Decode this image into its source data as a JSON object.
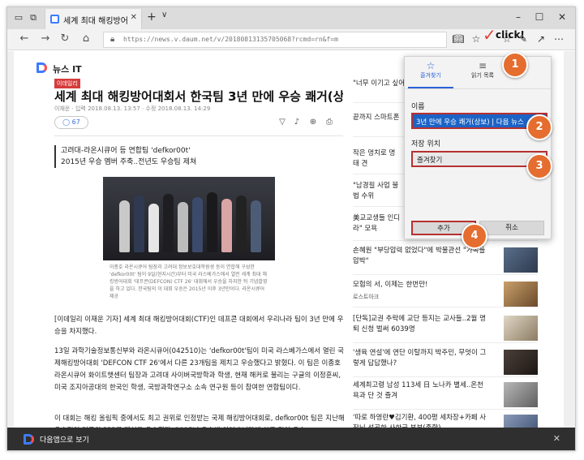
{
  "tab": {
    "title": "세계 최대 해킹방어대회"
  },
  "nav": {
    "url": "https://news.v.daum.net/v/20180813135705068?rcmd=rn&f=m"
  },
  "brand": {
    "section": "뉴스 IT"
  },
  "article": {
    "press": "이데일리",
    "headline": "세계 최대 해킹방어대회서 한국팀 3년 만에 우승 쾌거(상보)",
    "byline": "이재운 · 입력 2018.08.13. 13:57 · 수정 2018.08.13. 14:29",
    "comments": "67",
    "summary": [
      "고려대-라온시큐어 등 연합팀 'defkor00t'",
      "2015년 우승 멤버 주축..전년도 우승팀 제쳐"
    ],
    "caption": "이종호 라온시큐어 팀장과 고려대 정보보호대학원생 등이 연합해 구성한 'defkor00t' 팀이 9일(현지시간)부터 미국 라스베가스에서 열린 세계 최대 해킹방어대회 '데프콘(DEFCON) CTF 26' 대회에서 우승을 차지한 뒤 기념촬영을 하고 있다. 한국팀의 이 대회 우승은 2015년 이후 3년만이다. 라온시큐어 제공",
    "paragraphs": [
      "[이데일리 이재운 기자] 세계 최대 해킹방어대회(CTF)인 데프콘 대회에서 우리나라 팀이 3년 만에 우승을 차지했다.",
      "13일 과학기술정보통신부와 라온시큐어(042510)는 'defkor00t'팀이 미국 라스베가스에서 열린 국제해킹방어대회 'DEFCON CTF 26'에서 다른 23개팀을 제치고 우승했다고 밝혔다. 이 팀은 이종호 라온시큐어 화이트햇센터 팀장과 고려대 사이버국방학과 학생, 현재 해커로 불리는 구글의 이정훈씨, 미국 조지아공대의 한국인 학생, 국방과학연구소 소속 연구원 등이 참여한 연합팀이다.",
      "이 대회는 해킹 올림픽 중에서도 최고 권위로 인정받는 국제 해킹방어대회로, defkor00t 팀은 지난해 우승팀인 미국의 PPP를 제치고 우승했다. 2015년 우승에 이어 3년만에 한국 팀이 우승"
    ]
  },
  "right_column": [
    {
      "text": "\"너무 이기고 싶어",
      "thumb": false
    },
    {
      "text": "끝까지 스마트폰",
      "thumb": false
    },
    {
      "text": "작은 멍치로 명태 견",
      "thumb": false
    },
    {
      "text": "\"남경필 사업 불법 수위",
      "thumb": false
    },
    {
      "text": "美교교생들 인디 라\" 모욕",
      "thumb": false
    },
    {
      "text": "손혜원 \"부당압력 없었다\"에 박물관선 \"가족들 압박\"",
      "thumb": true
    },
    {
      "text": "모험의 서, 이제는 한번만!",
      "thumb": true,
      "ad": "로스트아크"
    },
    {
      "text": "[단독]교권 추락에 교단 등지는 교사들..2월 명퇴 신청 벌써 6039명",
      "thumb": true
    },
    {
      "text": "'생육 연설'에 연단 이탈까지 박주민, 무엇이 그렇게 답답했나?",
      "thumb": true
    },
    {
      "text": "세계최고령 남성 113세 日 노나카 별세..온천욕과 단 것 즐겨",
      "thumb": true
    },
    {
      "text": "'따로 하영란♥김기환, 400평 세차장+카페 사장님 성공한 사한국 부부(종합)",
      "thumb": true
    }
  ],
  "favorites": {
    "tab_favorites": "즐겨찾기",
    "tab_reading": "읽기 목록",
    "name_label": "이름",
    "name_value": "3년 만에 우승 쾌거(상보) | 다음 뉴스",
    "location_label": "저장 위치",
    "location_value": "즐겨찾기",
    "add_label": "추가",
    "cancel_label": "취소"
  },
  "annotations": {
    "click_text": "click!",
    "m1": "1",
    "m2": "2",
    "m3": "3",
    "m4": "4"
  },
  "bottom_bar": {
    "text": "다음앱으로 보기"
  },
  "colors": {
    "accent": "#2a62d9",
    "marker": "#e56d2f",
    "highlight": "#b73030",
    "selected": "#1c63c5"
  }
}
